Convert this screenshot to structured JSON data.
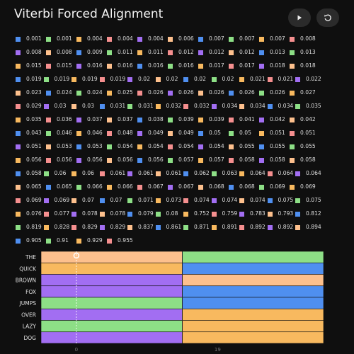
{
  "header": {
    "title": "Viterbi Forced Alignment",
    "play_icon": "play-icon",
    "reset_icon": "rotate-ccw-icon"
  },
  "colors": {
    "orange": "#f8b95f",
    "blue": "#4f8ff0",
    "salmon": "#f58f8f",
    "purple": "#a26ef2",
    "green": "#8ddf86",
    "peach": "#fdc08d"
  },
  "legend": {
    "swatch_order": [
      "blue",
      "green",
      "orange",
      "salmon",
      "purple",
      "peach"
    ],
    "items": [
      "0.001",
      "0.001",
      "0.004",
      "0.004",
      "0.004",
      "0.006",
      "0.007",
      "0.007",
      "0.007",
      "0.008",
      "0.008",
      "0.008",
      "0.009",
      "0.011",
      "0.011",
      "0.012",
      "0.012",
      "0.012",
      "0.013",
      "0.013",
      "0.015",
      "0.015",
      "0.016",
      "0.016",
      "0.016",
      "0.016",
      "0.017",
      "0.017",
      "0.018",
      "0.018",
      "0.019",
      "0.019",
      "0.019",
      "0.019",
      "0.02",
      "0.02",
      "0.02",
      "0.02",
      "0.021",
      "0.021",
      "0.022",
      "0.023",
      "0.024",
      "0.024",
      "0.025",
      "0.026",
      "0.026",
      "0.026",
      "0.026",
      "0.026",
      "0.027",
      "0.029",
      "0.03",
      "0.03",
      "0.031",
      "0.031",
      "0.032",
      "0.032",
      "0.034",
      "0.034",
      "0.034",
      "0.035",
      "0.035",
      "0.036",
      "0.037",
      "0.037",
      "0.038",
      "0.039",
      "0.039",
      "0.041",
      "0.042",
      "0.042",
      "0.043",
      "0.046",
      "0.046",
      "0.048",
      "0.049",
      "0.049",
      "0.05",
      "0.05",
      "0.051",
      "0.051",
      "0.051",
      "0.053",
      "0.053",
      "0.054",
      "0.054",
      "0.054",
      "0.054",
      "0.055",
      "0.055",
      "0.055",
      "0.056",
      "0.056",
      "0.056",
      "0.056",
      "0.056",
      "0.057",
      "0.057",
      "0.058",
      "0.058",
      "0.058",
      "0.058",
      "0.06",
      "0.06",
      "0.061",
      "0.061",
      "0.061",
      "0.062",
      "0.063",
      "0.064",
      "0.064",
      "0.064",
      "0.065",
      "0.065",
      "0.066",
      "0.066",
      "0.067",
      "0.067",
      "0.068",
      "0.068",
      "0.069",
      "0.069",
      "0.069",
      "0.069",
      "0.07",
      "0.07",
      "0.071",
      "0.073",
      "0.074",
      "0.074",
      "0.074",
      "0.075",
      "0.075",
      "0.076",
      "0.077",
      "0.078",
      "0.078",
      "0.079",
      "0.08",
      "0.752",
      "0.759",
      "0.783",
      "0.793",
      "0.812",
      "0.819",
      "0.828",
      "0.829",
      "0.829",
      "0.837",
      "0.861",
      "0.871",
      "0.891",
      "0.892",
      "0.892",
      "0.894",
      "0.905",
      "0.91",
      "0.929",
      "0.955"
    ]
  },
  "chart_data": {
    "type": "heatmap",
    "rows": [
      "THE",
      "QUICK",
      "BROWN",
      "FOX",
      "JUMPS",
      "OVER",
      "LAZY",
      "DOG"
    ],
    "x_ticks": [
      "0",
      "19"
    ],
    "columns": [
      [
        "peach",
        "orange",
        "purple",
        "purple",
        "green",
        "purple",
        "green",
        "purple"
      ],
      [
        "green",
        "blue",
        "peach",
        "blue",
        "blue",
        "orange",
        "orange",
        "orange"
      ]
    ],
    "cursor_x": 0.25
  }
}
